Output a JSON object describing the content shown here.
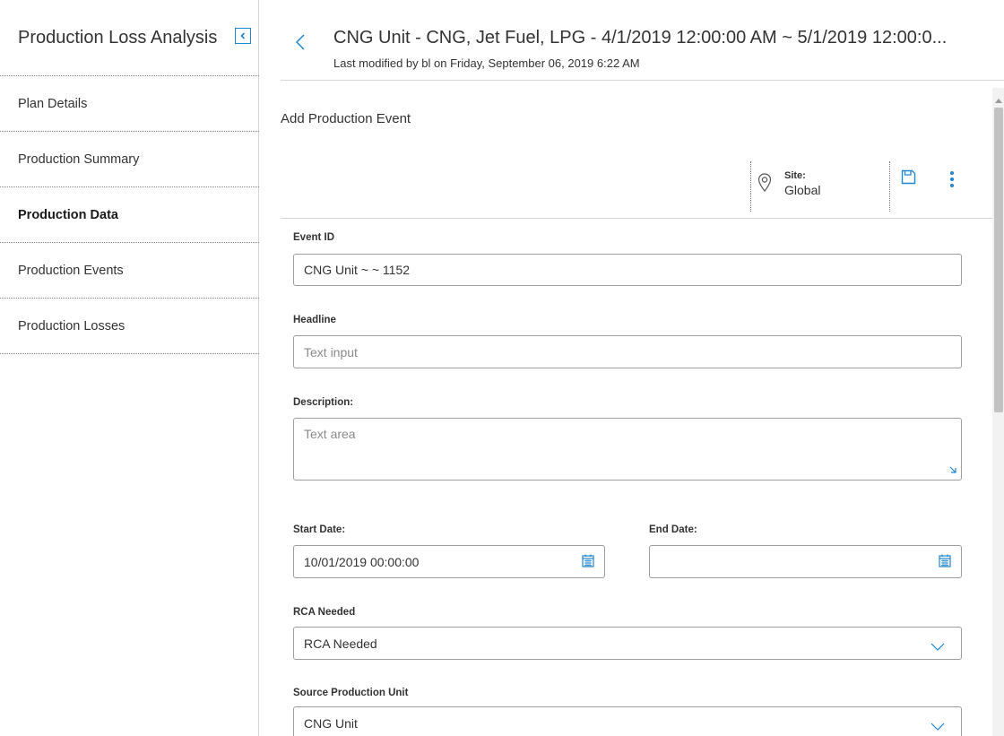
{
  "sidebar": {
    "title": "Production Loss Analysis",
    "items": [
      {
        "label": "Plan Details"
      },
      {
        "label": "Production Summary"
      },
      {
        "label": "Production Data"
      },
      {
        "label": "Production Events"
      },
      {
        "label": "Production Losses"
      }
    ],
    "active_item": "Production Data"
  },
  "header": {
    "title": "CNG Unit - CNG, Jet Fuel, LPG - 4/1/2019 12:00:00 AM ~ 5/1/2019 12:00:0...",
    "subtitle": "Last modified by bl on Friday, September 06, 2019 6:22 AM"
  },
  "form": {
    "title": "Add Production Event",
    "toolbar": {
      "site_label": "Site:",
      "site_value": "Global"
    },
    "event_id": {
      "label": "Event ID",
      "value": "CNG Unit ~ ~ 1152"
    },
    "headline": {
      "label": "Headline",
      "placeholder": "Text input"
    },
    "description": {
      "label": "Description:",
      "placeholder": "Text area"
    },
    "start_date": {
      "label": "Start Date:",
      "value": "10/01/2019 00:00:00"
    },
    "end_date": {
      "label": "End Date:",
      "value": ""
    },
    "rca_needed": {
      "label": "RCA Needed",
      "selected": "RCA Needed"
    },
    "source_unit": {
      "label": "Source Production Unit",
      "selected": "CNG Unit"
    }
  },
  "icons": {
    "collapse": "collapse-sidebar-icon",
    "back": "chevron-left-icon",
    "site": "location-pin-icon",
    "save": "save-icon",
    "more": "more-vertical-icon",
    "calendar": "calendar-icon",
    "dropdown": "chevron-down-icon"
  },
  "colors": {
    "accent": "#1f86d0",
    "border": "#9e9e9e",
    "divider": "#d6d6d6"
  }
}
